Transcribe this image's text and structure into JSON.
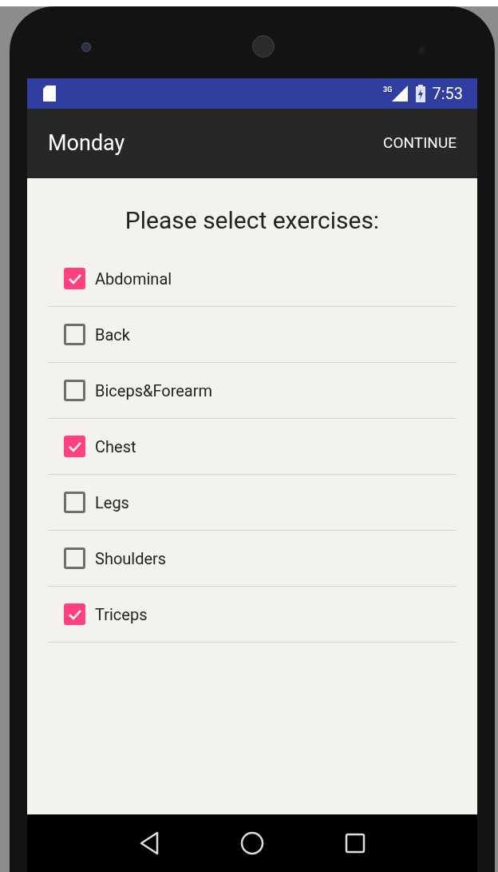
{
  "status_bar": {
    "network": "3G",
    "time": "7:53"
  },
  "app_bar": {
    "title": "Monday",
    "action": "CONTINUE"
  },
  "heading": "Please select exercises:",
  "exercises": [
    {
      "label": "Abdominal",
      "checked": true
    },
    {
      "label": "Back",
      "checked": false
    },
    {
      "label": "Biceps&Forearm",
      "checked": false
    },
    {
      "label": "Chest",
      "checked": true
    },
    {
      "label": "Legs",
      "checked": false
    },
    {
      "label": "Shoulders",
      "checked": false
    },
    {
      "label": "Triceps",
      "checked": true
    }
  ]
}
